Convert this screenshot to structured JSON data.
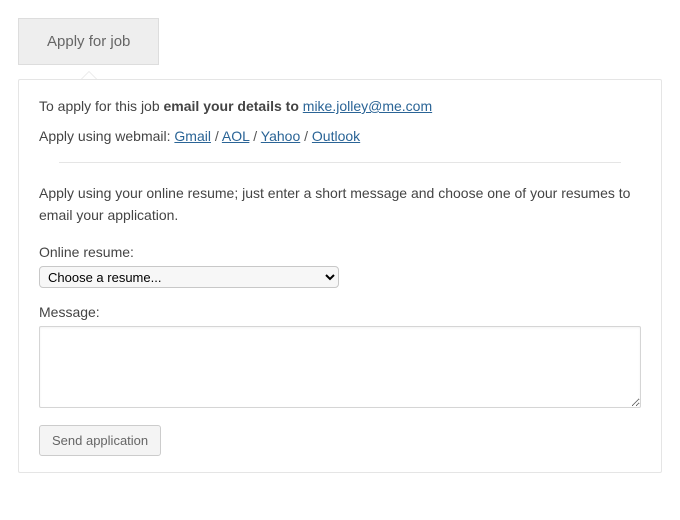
{
  "tab": {
    "label": "Apply for job"
  },
  "intro": {
    "prefix": "To apply for this job ",
    "bold": "email your details to ",
    "email": "mike.jolley@me.com"
  },
  "webmail": {
    "prefix": "Apply using webmail: ",
    "links": [
      "Gmail",
      "AOL",
      "Yahoo",
      "Outlook"
    ],
    "separator": " / "
  },
  "resume_section": {
    "info": "Apply using your online resume; just enter a short message and choose one of your resumes to email your application.",
    "label": "Online resume:",
    "placeholder_option": "Choose a resume..."
  },
  "message_section": {
    "label": "Message:",
    "value": ""
  },
  "send_button": {
    "label": "Send application"
  }
}
